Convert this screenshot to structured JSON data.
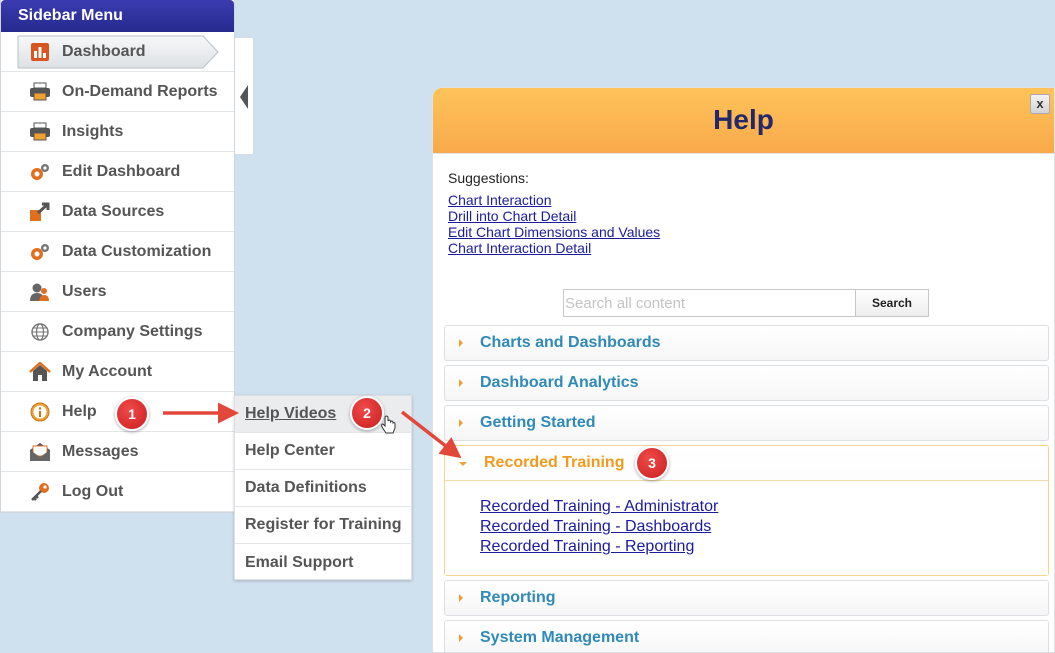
{
  "sidebar": {
    "title": "Sidebar Menu",
    "items": [
      {
        "label": "Dashboard",
        "icon": "bar-chart-icon",
        "active": true
      },
      {
        "label": "On-Demand Reports",
        "icon": "printer-icon"
      },
      {
        "label": "Insights",
        "icon": "printer-icon"
      },
      {
        "label": "Edit Dashboard",
        "icon": "gears-icon"
      },
      {
        "label": "Data Sources",
        "icon": "data-source-arrow-icon"
      },
      {
        "label": "Data Customization",
        "icon": "gears-icon"
      },
      {
        "label": "Users",
        "icon": "users-icon"
      },
      {
        "label": "Company Settings",
        "icon": "globe-icon"
      },
      {
        "label": "My Account",
        "icon": "home-icon"
      },
      {
        "label": "Help",
        "icon": "info-icon"
      },
      {
        "label": "Messages",
        "icon": "envelope-icon"
      },
      {
        "label": "Log Out",
        "icon": "key-icon"
      }
    ]
  },
  "submenu": {
    "items": [
      "Help Videos",
      "Help Center",
      "Data Definitions",
      "Register for Training",
      "Email Support"
    ]
  },
  "badges": [
    "1",
    "2",
    "3"
  ],
  "help": {
    "title": "Help",
    "close_label": "x",
    "suggestions_title": "Suggestions:",
    "suggestions": [
      "Chart Interaction",
      "Drill into Chart Detail",
      "Edit Chart Dimensions and Values",
      "Chart Interaction Detail"
    ],
    "search": {
      "placeholder": "Search all content",
      "value": "",
      "button_label": "Search"
    },
    "sections": [
      {
        "label": "Charts and Dashboards",
        "open": false
      },
      {
        "label": "Dashboard Analytics",
        "open": false
      },
      {
        "label": "Getting Started",
        "open": false
      },
      {
        "label": "Recorded Training",
        "open": true,
        "links": [
          "Recorded Training - Administrator",
          "Recorded Training - Dashboards",
          "Recorded Training - Reporting"
        ]
      },
      {
        "label": "Reporting",
        "open": false
      },
      {
        "label": "System Management",
        "open": false
      }
    ]
  },
  "colors": {
    "header_blue": "#262a8e",
    "help_orange": "#f9a94a",
    "accent_orange": "#f39a1e",
    "link_blue": "#1b1b9e",
    "section_blue": "#2f8ab8",
    "badge_red": "#c91e1e",
    "arrow_red": "#e2473a"
  }
}
